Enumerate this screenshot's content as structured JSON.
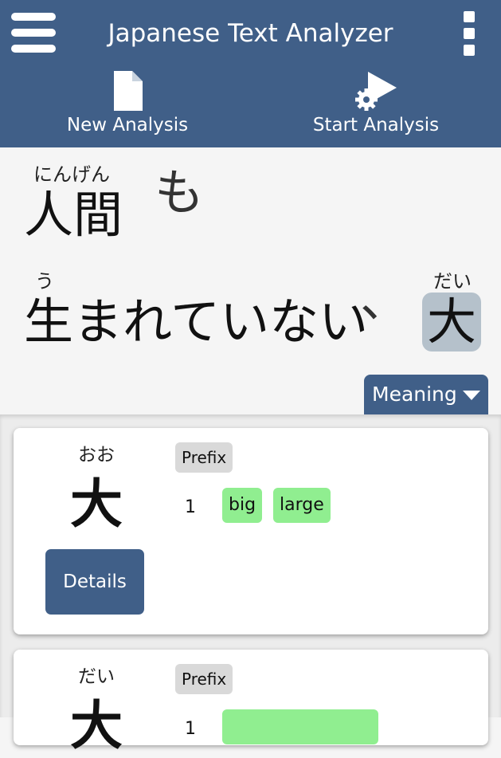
{
  "app": {
    "title": "Japanese Text Analyzer"
  },
  "toolbar": {
    "new_label": "New Analysis",
    "start_label": "Start Analysis"
  },
  "sentence": {
    "line1": [
      {
        "furigana": "にんげん",
        "surface": "人間"
      },
      {
        "furigana": "",
        "surface": "も"
      }
    ],
    "line2": [
      {
        "furigana": "う",
        "surface": "生まれていない"
      },
      {
        "furigana": "",
        "surface": "、"
      },
      {
        "furigana": "だい",
        "surface": "大",
        "selected": true
      }
    ]
  },
  "meaning_button": {
    "label": "Meaning"
  },
  "results": [
    {
      "reading": "おお",
      "kanji": "大",
      "pos": "Prefix",
      "sense_number": "1",
      "glosses": [
        "big",
        "large"
      ],
      "details_label": "Details"
    },
    {
      "reading": "だい",
      "kanji": "大",
      "pos": "Prefix",
      "sense_number": "1",
      "glosses": [
        ""
      ]
    }
  ],
  "colors": {
    "header": "#405f88",
    "selected_word": "#b5c1cb",
    "gloss": "#90ee90",
    "tag": "#d9d9d9"
  }
}
